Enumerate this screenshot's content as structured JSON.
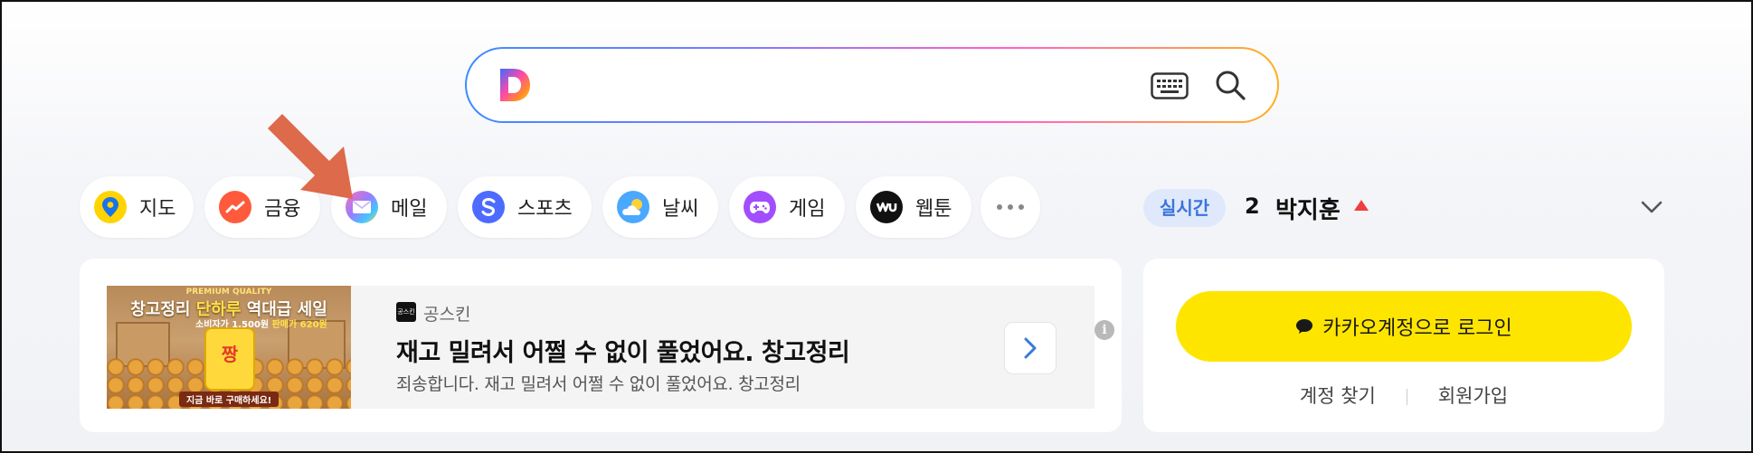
{
  "search": {
    "placeholder": ""
  },
  "services": [
    {
      "label": "지도",
      "icon": "map-pin-icon",
      "color": "#ffd400"
    },
    {
      "label": "금융",
      "icon": "finance-chart-icon",
      "color": "#ff5a3c"
    },
    {
      "label": "메일",
      "icon": "mail-icon",
      "color": "#9b7bff"
    },
    {
      "label": "스포츠",
      "icon": "sports-icon",
      "color": "#4d6bff"
    },
    {
      "label": "날씨",
      "icon": "weather-cloud-icon",
      "color": "#4aa8ff"
    },
    {
      "label": "게임",
      "icon": "game-controller-icon",
      "color": "#a24dff"
    },
    {
      "label": "웹툰",
      "icon": "webtoon-icon",
      "color": "#111111"
    }
  ],
  "realtime": {
    "badge": "실시간",
    "rank": "2",
    "keyword": "박지훈",
    "trend": "up"
  },
  "ad": {
    "image": {
      "header_small": "PREMIUM QUALITY",
      "headline_a": "창고정리 ",
      "headline_b": "단하루",
      "headline_c": " 역대급 세일",
      "price_a": "소비자가 1,500원 ",
      "price_b": "판매가 620원",
      "bag_text": "짱",
      "cta": "지금 바로 구매하세요!"
    },
    "brand_logo": "공스킨",
    "brand": "공스킨",
    "title": "재고 밀려서 어쩔 수 없이 풀었어요. 창고정리",
    "description": "죄송합니다. 재고 밀려서 어쩔 수 없이 풀었어요. 창고정리",
    "info": "i"
  },
  "login": {
    "kakao_label": "카카오계정으로 로그인",
    "find_account": "계정 찾기",
    "signup": "회원가입"
  },
  "colors": {
    "kakao_yellow": "#fee500",
    "realtime_badge_bg": "#dfe9fb",
    "realtime_badge_text": "#3b73d9",
    "trend_up": "#f03e3e",
    "annotation_arrow": "#dd6a4a"
  }
}
